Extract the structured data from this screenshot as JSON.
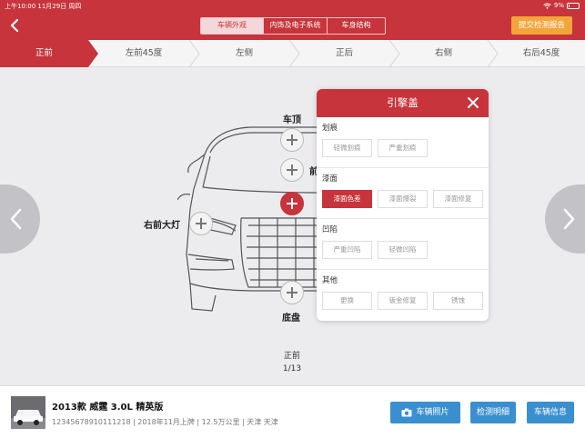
{
  "status": {
    "time": "上午10:00  11月29日 周四",
    "battery": "9%"
  },
  "header": {
    "segments": [
      "车辆外观",
      "内饰及电子系统",
      "车身结构"
    ],
    "active_segment": 0,
    "submit_label": "提交检测报告"
  },
  "angle_tabs": [
    "正前",
    "左前45度",
    "左侧",
    "正后",
    "右侧",
    "右后45度"
  ],
  "active_tab": 0,
  "car_labels": {
    "roof": "车顶",
    "front_truncated": "前",
    "right_headlight": "右前大灯",
    "chassis": "底盘"
  },
  "caption": {
    "view": "正前",
    "page": "1/13"
  },
  "popup": {
    "title": "引擎盖",
    "groups": [
      {
        "title": "划痕",
        "options": [
          "轻微划痕",
          "严重划痕"
        ],
        "selected": -1
      },
      {
        "title": "漆面",
        "options": [
          "漆面色差",
          "漆面爆裂",
          "漆面修复"
        ],
        "selected": 0
      },
      {
        "title": "凹陷",
        "options": [
          "严重凹陷",
          "轻微凹陷"
        ],
        "selected": -1
      },
      {
        "title": "其他",
        "options": [
          "更换",
          "钣金修复",
          "锈蚀"
        ],
        "selected": -1
      }
    ]
  },
  "vehicle": {
    "title": "2013款 威霆 3.0L 精英版",
    "info": "12345678910111218 | 2018年11月上牌 | 12.5万公里 | 天津 天津"
  },
  "buttons": {
    "photos": "车辆照片",
    "details": "检测明细",
    "info": "车辆信息"
  },
  "colors": {
    "brand_red": "#c7343b",
    "submit_orange": "#f3a43b",
    "button_blue": "#3a8fd0"
  }
}
